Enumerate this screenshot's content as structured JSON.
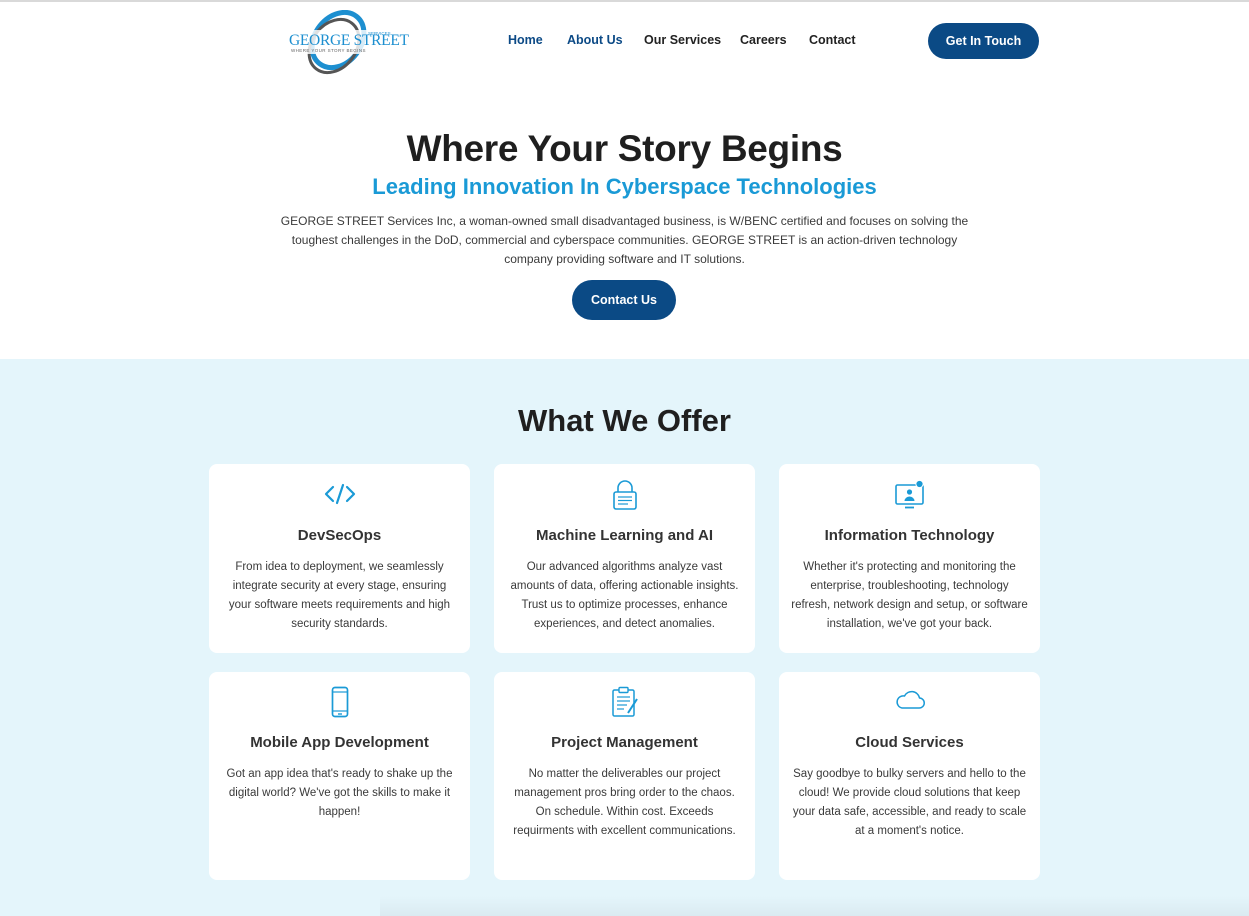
{
  "header": {
    "logo": {
      "text": "GEORGE STREET",
      "tagline": "WHERE YOUR STORY BEGINS",
      "group": "SERVICES"
    },
    "nav": [
      {
        "label": "Home",
        "active": true
      },
      {
        "label": "About Us",
        "active": true
      },
      {
        "label": "Our Services",
        "active": false
      },
      {
        "label": "Careers",
        "active": false
      },
      {
        "label": "Contact",
        "active": false
      }
    ],
    "cta_label": "Get In Touch"
  },
  "hero": {
    "title": "Where Your Story Begins",
    "subtitle": "Leading Innovation In Cyberspace Technologies",
    "description": "GEORGE STREET Services Inc, a woman-owned small disadvantaged business, is W/BENC certified and focuses on solving the toughest challenges in the DoD, commercial and cyberspace communities. GEORGE STREET is an action-driven technology company providing software and IT solutions.",
    "button_label": "Contact Us"
  },
  "offer": {
    "title": "What We Offer",
    "cards": [
      {
        "icon": "code-icon",
        "title": "DevSecOps",
        "description": "From idea to deployment, we seamlessly integrate security at every stage, ensuring your software meets requirements and high security standards."
      },
      {
        "icon": "lock-icon",
        "title": "Machine Learning and AI",
        "description": "Our advanced algorithms analyze vast amounts of data, offering actionable insights. Trust us to optimize processes, enhance experiences, and detect anomalies."
      },
      {
        "icon": "monitor-user-icon",
        "title": "Information Technology",
        "description": "Whether it's protecting and monitoring the enterprise, troubleshooting, technology refresh, network design and setup, or software installation, we've got your back."
      },
      {
        "icon": "mobile-phone-icon",
        "title": "Mobile App Development",
        "description": "Got an app idea that's ready to shake up the digital world? We've got the skills to make it happen!"
      },
      {
        "icon": "clipboard-icon",
        "title": "Project Management",
        "description": "No matter the deliverables our project management pros bring order to the chaos. On schedule. Within cost. Exceeds requirments with excellent communications."
      },
      {
        "icon": "cloud-icon",
        "title": "Cloud Services",
        "description": "Say goodbye to bulky servers and hello to the cloud! We provide cloud solutions that keep your data safe, accessible, and ready to scale at a moment's notice."
      }
    ]
  },
  "colors": {
    "primary": "#0b4a85",
    "accent": "#1a9ad6",
    "section_bg": "#e4f5fb"
  }
}
